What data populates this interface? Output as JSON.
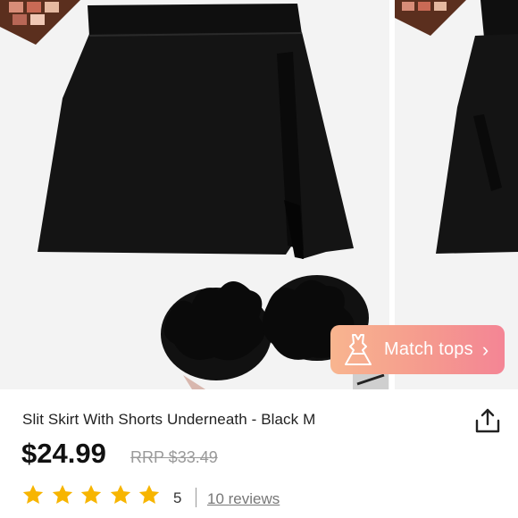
{
  "gallery": {
    "match_label": "Match tops",
    "icons": [
      "dress-icon",
      "chevron-right-icon"
    ]
  },
  "product": {
    "title": "Slit Skirt With Shorts Underneath - Black M",
    "price": "$24.99",
    "rrp": "RRP $33.49",
    "rating": "5",
    "stars": 5,
    "reviews_link": "10 reviews"
  },
  "colors": {
    "star": "#f7b500",
    "accent_start": "#f8b58f",
    "accent_end": "#f48595"
  },
  "icons": [
    "share-icon",
    "star-icon"
  ]
}
